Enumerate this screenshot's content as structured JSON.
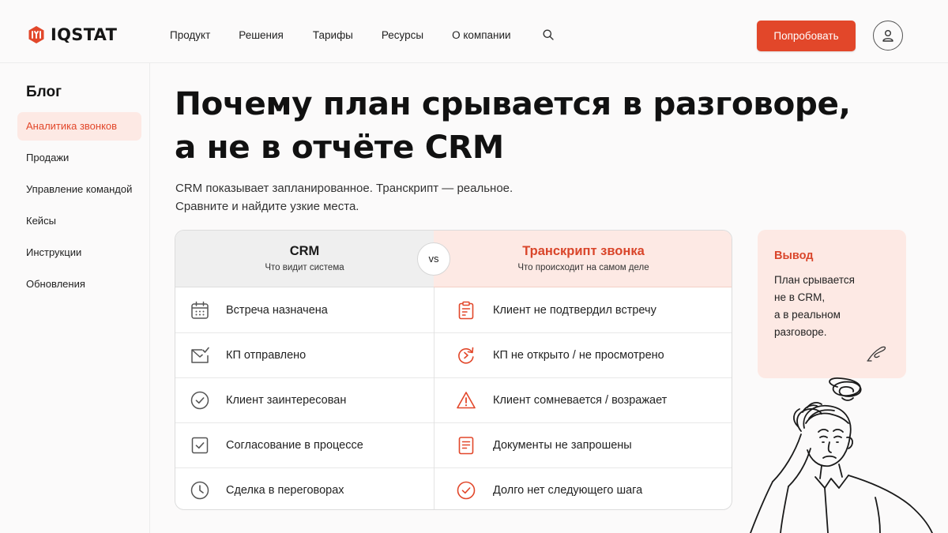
{
  "brand": {
    "name": "IQSTAT",
    "accent": "#e2472a",
    "accent_soft": "#fde9e4"
  },
  "header": {
    "nav": [
      "Продукт",
      "Решения",
      "Тарифы",
      "Ресурсы",
      "О компании"
    ],
    "search_icon": "search-icon",
    "cta_label": "Попробовать",
    "profile_icon": "user-icon"
  },
  "sidebar": {
    "title": "Блог",
    "items": [
      {
        "label": "Аналитика звонков",
        "active": true
      },
      {
        "label": "Продажи",
        "active": false
      },
      {
        "label": "Управление командой",
        "active": false
      },
      {
        "label": "Кейсы",
        "active": false
      },
      {
        "label": "Инструкции",
        "active": false
      },
      {
        "label": "Обновления",
        "active": false
      }
    ]
  },
  "main": {
    "title_lines": [
      "Почему план срывается в разговоре,",
      "а не в отчёте CRM"
    ],
    "subtitle_lines": [
      "CRM показывает запланированное. Транскрипт — реальное.",
      "Сравните и найдите узкие места."
    ]
  },
  "comparison": {
    "vs_label": "vs",
    "left": {
      "title": "CRM",
      "subtitle": "Что видит система",
      "rows": [
        {
          "label": "Встреча назначена",
          "icon": "calendar-icon"
        },
        {
          "label": "КП отправлено",
          "icon": "mail-check-icon"
        },
        {
          "label": "Клиент заинтересован",
          "icon": "check-circle-icon"
        },
        {
          "label": "Согласование в процессе",
          "icon": "checkbox-icon"
        },
        {
          "label": "Сделка в переговорах",
          "icon": "clock-icon"
        }
      ]
    },
    "right": {
      "title": "Транскрипт звонка",
      "subtitle": "Что происходит на самом деле",
      "rows": [
        {
          "label": "Клиент не подтвердил встречу",
          "icon": "clipboard-icon"
        },
        {
          "label": "КП не открыто / не просмотрено",
          "icon": "refresh-icon"
        },
        {
          "label": "Клиент сомневается / возражает",
          "icon": "warning-icon"
        },
        {
          "label": "Документы не запрошены",
          "icon": "document-icon"
        },
        {
          "label": "Долго нет следующего шага",
          "icon": "check-circle-icon"
        }
      ]
    }
  },
  "conclusion": {
    "title": "Вывод",
    "lines": [
      "План срывается",
      "не в CRM,",
      "а в реальном",
      "разговоре."
    ]
  }
}
